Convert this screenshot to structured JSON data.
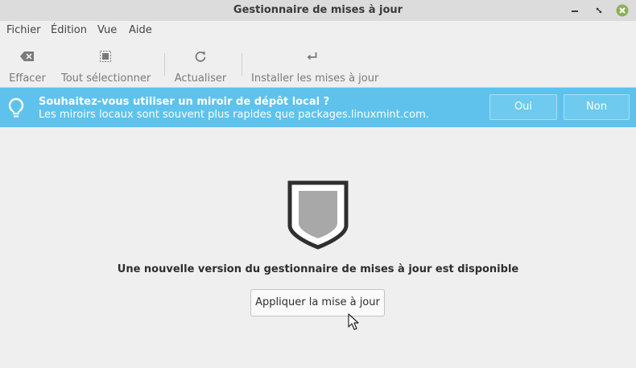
{
  "window": {
    "title": "Gestionnaire de mises à jour"
  },
  "menubar": {
    "items": [
      "Fichier",
      "Édition",
      "Vue",
      "Aide"
    ]
  },
  "toolbar": {
    "clear_label": "Effacer",
    "select_all_label": "Tout sélectionner",
    "refresh_label": "Actualiser",
    "install_label": "Installer les mises à jour"
  },
  "infobar": {
    "question": "Souhaitez-vous utiliser un miroir de dépôt local ?",
    "detail": "Les miroirs locaux sont souvent plus rapides que packages.linuxmint.com.",
    "yes_label": "Oui",
    "no_label": "Non",
    "color": "#5ec2ec"
  },
  "main": {
    "message": "Une nouvelle version du gestionnaire de mises à jour est disponible",
    "apply_label": "Appliquer la mise à jour"
  },
  "icons": {
    "window_close": "close-icon",
    "clear": "backspace-icon",
    "select_all": "select-all-icon",
    "refresh": "refresh-icon",
    "install": "enter-icon",
    "info": "lightbulb-icon",
    "status": "shield-icon"
  },
  "colors": {
    "close_button": "#8bb158"
  }
}
